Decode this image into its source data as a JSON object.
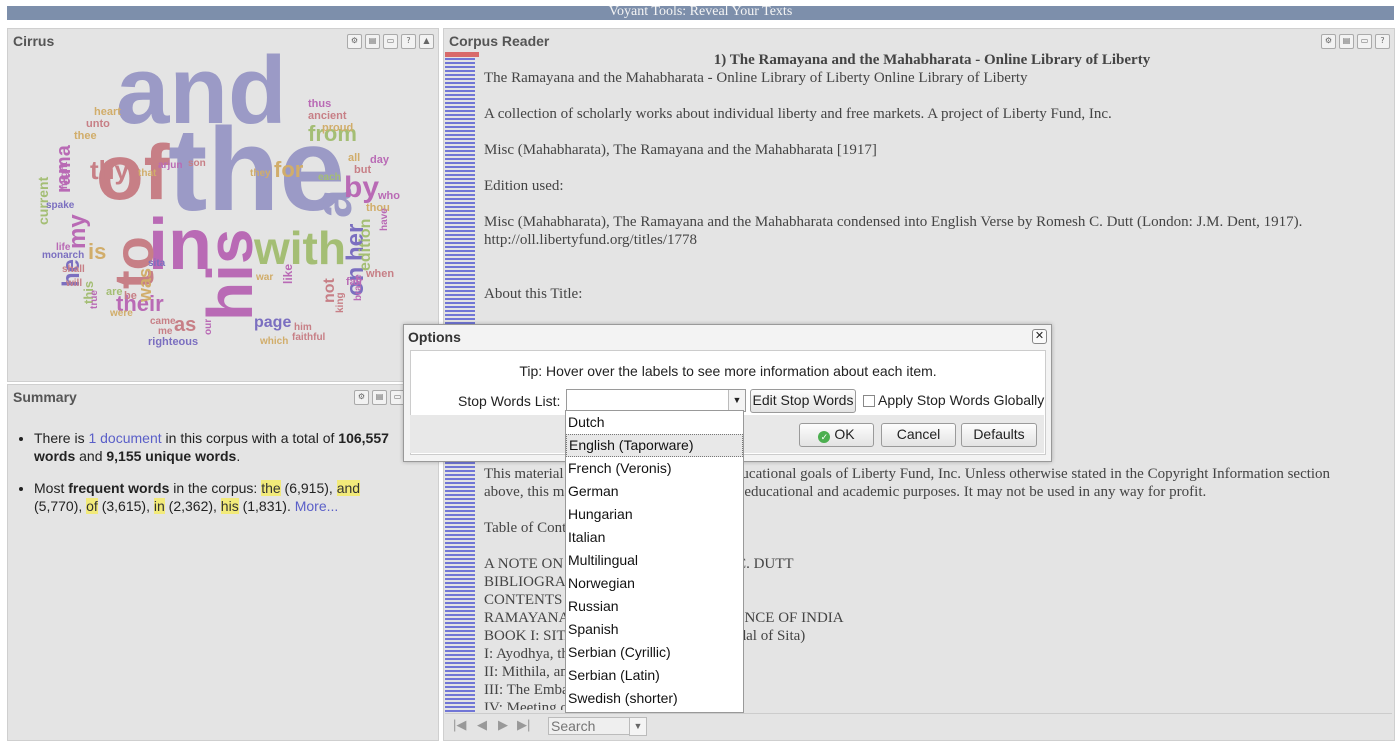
{
  "app": {
    "title": "Voyant Tools: Reveal Your Texts"
  },
  "cirrus": {
    "title": "Cirrus",
    "words": [
      {
        "text": "and",
        "color": "#9b9ac6"
      },
      {
        "text": "the",
        "color": "#9b9ac6"
      },
      {
        "text": "of",
        "color": "#c77f86"
      },
      {
        "text": "in",
        "color": "#b96ab5"
      },
      {
        "text": "his",
        "color": "#b96ab5"
      },
      {
        "text": "to",
        "color": "#c77f86"
      },
      {
        "text": "with",
        "color": "#a4be74"
      },
      {
        "text": "a",
        "color": "#9b9ac6"
      },
      {
        "text": "by",
        "color": "#b96ab5"
      },
      {
        "text": "her",
        "color": "#7b6fc0"
      },
      {
        "text": "on",
        "color": "#7b6fc0"
      },
      {
        "text": "from",
        "color": "#a4be74"
      },
      {
        "text": "thy",
        "color": "#c77f86"
      },
      {
        "text": "for",
        "color": "#d1ad6a"
      },
      {
        "text": "my",
        "color": "#b96ab5"
      },
      {
        "text": "he",
        "color": "#7b6fc0"
      },
      {
        "text": "rama",
        "color": "#b96ab5"
      },
      {
        "text": "is",
        "color": "#d1ad6a"
      },
      {
        "text": "their",
        "color": "#b96ab5"
      },
      {
        "text": "as",
        "color": "#c77f86"
      },
      {
        "text": "was",
        "color": "#d1ad6a"
      },
      {
        "text": "page",
        "color": "#7b6fc0"
      },
      {
        "text": "edition",
        "color": "#a4be74"
      },
      {
        "text": "not",
        "color": "#c77f86"
      },
      {
        "text": "current",
        "color": "#a4be74"
      },
      {
        "text": "this",
        "color": "#a4be74"
      },
      {
        "text": "heart",
        "color": "#d1ad6a"
      },
      {
        "text": "unto",
        "color": "#c77f86"
      },
      {
        "text": "thee",
        "color": "#d1ad6a"
      },
      {
        "text": "thus",
        "color": "#b96ab5"
      },
      {
        "text": "ancient",
        "color": "#c77f86"
      },
      {
        "text": "proud",
        "color": "#d1ad6a"
      },
      {
        "text": "all",
        "color": "#d1ad6a"
      },
      {
        "text": "day",
        "color": "#b96ab5"
      },
      {
        "text": "but",
        "color": "#c77f86"
      },
      {
        "text": "they",
        "color": "#d1ad6a"
      },
      {
        "text": "that",
        "color": "#d1ad6a"
      },
      {
        "text": "arjun",
        "color": "#b96ab5"
      },
      {
        "text": "son",
        "color": "#c77f86"
      },
      {
        "text": "each",
        "color": "#a4be74"
      },
      {
        "text": "who",
        "color": "#b96ab5"
      },
      {
        "text": "thou",
        "color": "#d1ad6a"
      },
      {
        "text": "have",
        "color": "#b96ab5"
      },
      {
        "text": "spake",
        "color": "#7b6fc0"
      },
      {
        "text": "might",
        "color": "#b96ab5"
      },
      {
        "text": "monarch",
        "color": "#7b6fc0"
      },
      {
        "text": "shall",
        "color": "#c77f86"
      },
      {
        "text": "will",
        "color": "#c77f86"
      },
      {
        "text": "life",
        "color": "#b96ab5"
      },
      {
        "text": "sita",
        "color": "#7b6fc0"
      },
      {
        "text": "war",
        "color": "#d1ad6a"
      },
      {
        "text": "like",
        "color": "#b96ab5"
      },
      {
        "text": "when",
        "color": "#c77f86"
      },
      {
        "text": "fair",
        "color": "#b96ab5"
      },
      {
        "text": "king",
        "color": "#c77f86"
      },
      {
        "text": "brave",
        "color": "#b96ab5"
      },
      {
        "text": "are",
        "color": "#a4be74"
      },
      {
        "text": "be",
        "color": "#c77f86"
      },
      {
        "text": "true",
        "color": "#b96ab5"
      },
      {
        "text": "were",
        "color": "#d1ad6a"
      },
      {
        "text": "came",
        "color": "#c77f86"
      },
      {
        "text": "me",
        "color": "#c77f86"
      },
      {
        "text": "our",
        "color": "#b96ab5"
      },
      {
        "text": "him",
        "color": "#c77f86"
      },
      {
        "text": "faithful",
        "color": "#c77f86"
      },
      {
        "text": "which",
        "color": "#d1ad6a"
      },
      {
        "text": "righteous",
        "color": "#7b6fc0"
      }
    ]
  },
  "summary": {
    "title": "Summary",
    "line1": {
      "a": "There is ",
      "link": "1 document",
      "b": " in this corpus with a total of ",
      "total": "106,557",
      "c": " words",
      "d": " and ",
      "unique": "9,155 unique words",
      "e": "."
    },
    "line2": {
      "a": "Most ",
      "b": "frequent words",
      "c": " in the corpus: ",
      "terms": [
        {
          "term": "the",
          "count": " (6,915), "
        },
        {
          "term": "and",
          "count": " (5,770), "
        },
        {
          "term": "of",
          "count": " (3,615), "
        },
        {
          "term": "in",
          "count": " (2,362), "
        },
        {
          "term": "his",
          "count": " (1,831). "
        }
      ],
      "more": "More..."
    }
  },
  "reader": {
    "title": "Corpus Reader",
    "doc_title": "1) The Ramayana and the Mahabharata - Online Library of Liberty",
    "lines": [
      "The Ramayana and the Mahabharata - Online Library of Liberty Online Library of Liberty",
      "A collection of scholarly works about individual liberty and free markets. A project of Liberty Fund, Inc.",
      "Misc (Mahabharata), The Ramayana and the Mahabharata [1917]",
      "Edition used:",
      "Misc (Mahabharata), The Ramayana and the Mahabharata condensed into English Verse by Romesh C. Dutt (London: J.M. Dent, 1917).",
      "http://oll.libertyfund.org/titles/1778",
      "About this Title:",
      "This material is put online to further the educational goals of Liberty Fund, Inc. Unless otherwise stated in the Copyright Information section",
      "above, this material may be used freely for educational and academic purposes. It may not be used in any way for profit.",
      "Table of Contents",
      "A NOTE ON THE BOOK BY ROMESH C. DUTT",
      "BIBLIOGRAPHY",
      "CONTENTS",
      "RAMAYANA, THE EPIC OF RAMA, PRINCE OF INDIA",
      "BOOK I: SITA-SWAYAMVARA (The Bridal of Sita)",
      "I: Ayodhya, the Righteous City",
      "II: Mithila, and the Breaking of the Bow",
      "III: The Embassy to Ayodhya",
      "IV: Meeting of the Monarchs"
    ],
    "search_placeholder": "Search"
  },
  "options": {
    "title": "Options",
    "tip": "Tip: Hover over the labels to see more information about each item.",
    "stop_label": "Stop Words List:",
    "stop_value": "",
    "edit_label": "Edit Stop Words",
    "apply_label": "Apply Stop Words Globally",
    "ok_label": "OK",
    "cancel_label": "Cancel",
    "defaults_label": "Defaults",
    "stop_options": [
      "Dutch",
      "English (Taporware)",
      "French (Veronis)",
      "German",
      "Hungarian",
      "Italian",
      "Multilingual",
      "Norwegian",
      "Russian",
      "Spanish",
      "Serbian (Cyrillic)",
      "Serbian (Latin)",
      "Swedish (shorter)"
    ]
  }
}
